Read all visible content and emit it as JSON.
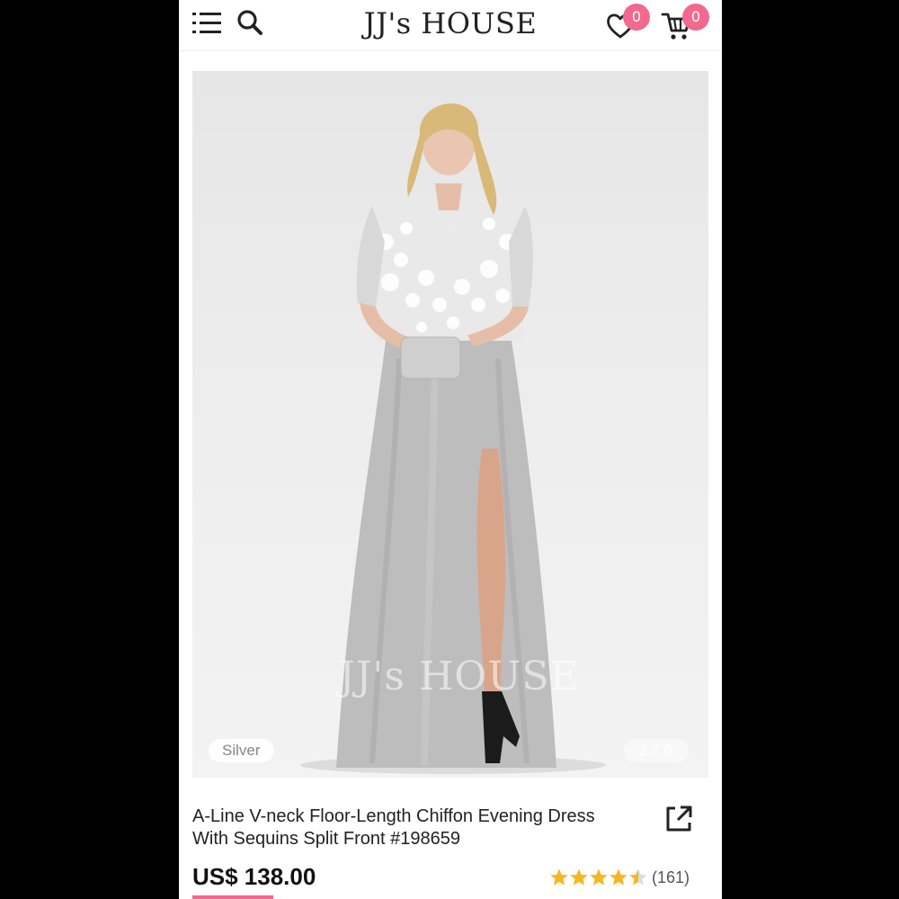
{
  "header": {
    "logo_text": "JJ's HOUSE",
    "wishlist_count": "0",
    "cart_count": "0",
    "icons": [
      "menu-icon",
      "search-icon",
      "heart-icon",
      "cart-icon"
    ]
  },
  "gallery": {
    "watermark": "JJ's HOUSE",
    "color_label": "Silver",
    "image_counter": "2 / 6"
  },
  "product": {
    "title_line1": "A-Line V-neck Floor-Length Chiffon Evening Dress",
    "title_line2": "With Sequins Split Front #198659",
    "price": "US$ 138.00",
    "rating_value": 4.5,
    "rating_count": "(161)"
  },
  "colors": {
    "accent": "#f2698f",
    "star": "#f5b820",
    "text": "#222222"
  }
}
